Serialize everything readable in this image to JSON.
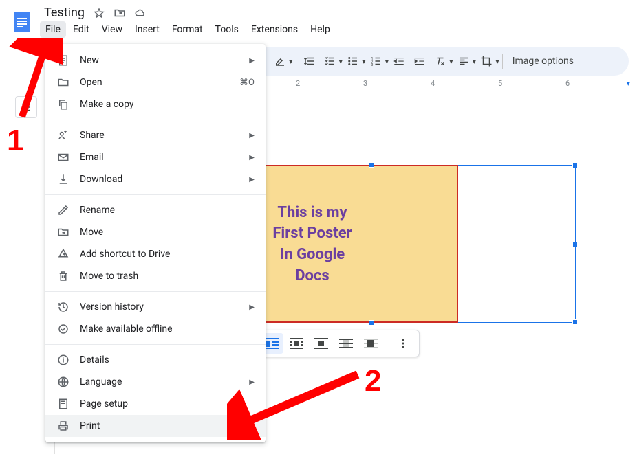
{
  "doc": {
    "title": "Testing"
  },
  "menubar": [
    "File",
    "Edit",
    "View",
    "Insert",
    "Format",
    "Tools",
    "Extensions",
    "Help"
  ],
  "toolbar": {
    "image_options": "Image options"
  },
  "ruler": {
    "ticks": [
      "2",
      "3",
      "4",
      "5",
      "6"
    ]
  },
  "poster": {
    "line1": "This is my",
    "line2": "First Poster",
    "line3": "In Google",
    "line4": "Docs"
  },
  "file_menu": {
    "new": "New",
    "open": "Open",
    "open_shortcut": "⌘O",
    "copy": "Make a copy",
    "share": "Share",
    "email": "Email",
    "download": "Download",
    "rename": "Rename",
    "move": "Move",
    "shortcut": "Add shortcut to Drive",
    "trash": "Move to trash",
    "history": "Version history",
    "offline": "Make available offline",
    "details": "Details",
    "language": "Language",
    "page_setup": "Page setup",
    "print": "Print"
  },
  "annotations": {
    "one": "1",
    "two": "2"
  }
}
